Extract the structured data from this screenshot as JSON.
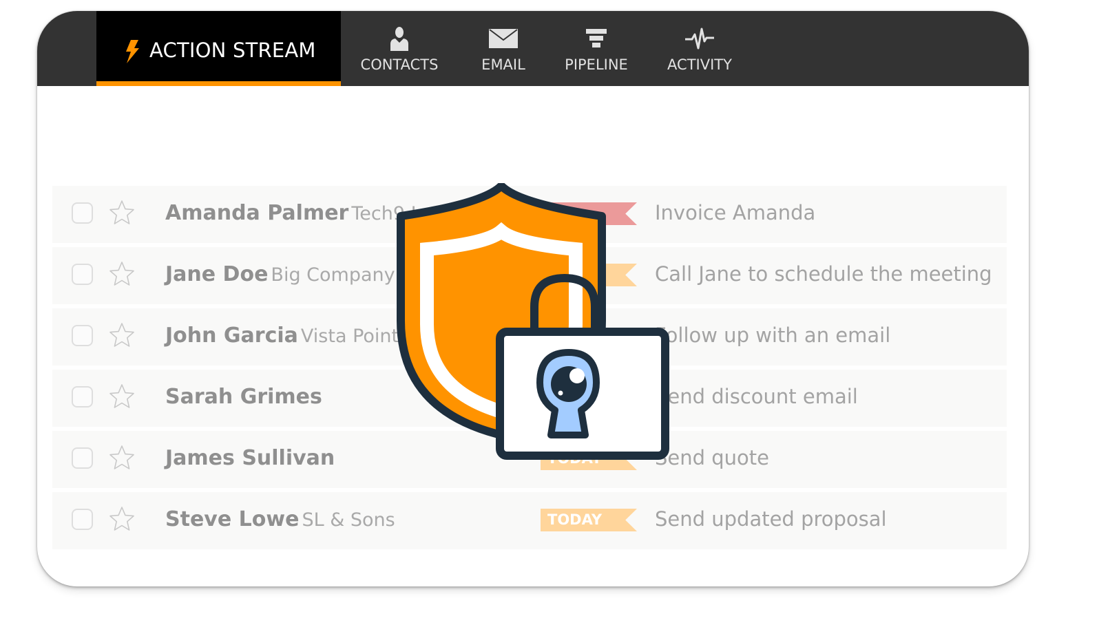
{
  "nav": {
    "active": {
      "label": "ACTION STREAM",
      "icon": "lightning-bolt-icon"
    },
    "items": [
      {
        "label": "CONTACTS",
        "icon": "person-icon"
      },
      {
        "label": "EMAIL",
        "icon": "envelope-icon"
      },
      {
        "label": "PIPELINE",
        "icon": "funnel-icon"
      },
      {
        "label": "ACTIVITY",
        "icon": "pulse-icon"
      }
    ]
  },
  "colors": {
    "accent": "#ff9300",
    "navbar": "#333333",
    "nav_active": "#000000",
    "badge_overdue": "#eb9a9a",
    "badge_today": "#ffd59b",
    "shield_fill": "#ff9300",
    "outline": "#1e2f3e",
    "keyhole": "#a3ccff"
  },
  "rows": [
    {
      "name": "Amanda Palmer",
      "company": "Tech9 Inc",
      "badge": "",
      "badge_type": "overdue",
      "task": "Invoice Amanda"
    },
    {
      "name": "Jane Doe",
      "company": "Big Company Inc",
      "badge": "",
      "badge_type": "today",
      "task": "Call Jane to schedule the meeting"
    },
    {
      "name": "John Garcia",
      "company": "Vista Point",
      "badge": "",
      "badge_type": "none",
      "task": "Follow up with an email"
    },
    {
      "name": "Sarah Grimes",
      "company": "",
      "badge": "",
      "badge_type": "none",
      "task": "Send discount email"
    },
    {
      "name": "James Sullivan",
      "company": "",
      "badge": "TODAY",
      "badge_type": "today",
      "task": "Send quote"
    },
    {
      "name": "Steve Lowe",
      "company": "SL & Sons",
      "badge": "TODAY",
      "badge_type": "today",
      "task": "Send updated proposal"
    }
  ],
  "overlay": {
    "icon": "shield-lock-icon"
  }
}
